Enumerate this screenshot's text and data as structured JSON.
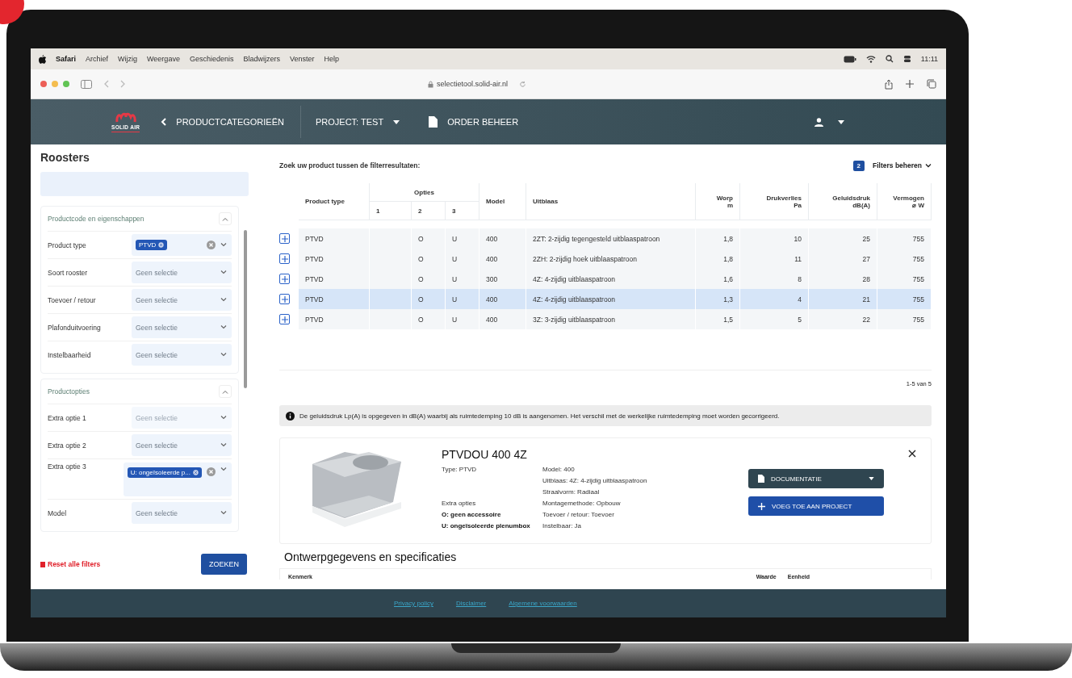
{
  "menubar": {
    "items": [
      "Safari",
      "Archief",
      "Wijzig",
      "Weergave",
      "Geschiedenis",
      "Bladwijzers",
      "Venster",
      "Help"
    ],
    "time": "11:11"
  },
  "browser": {
    "url": "selectietool.solid-air.nl"
  },
  "header": {
    "logo": "SOLID AIR",
    "back": "PRODUCTCATEGORIEËN",
    "project": "PROJECT: TEST",
    "orders": "ORDER BEHEER"
  },
  "sidebar": {
    "title": "Roosters",
    "groups": [
      {
        "title": "Productcode en eigenschappen",
        "expanded": true,
        "filters": [
          {
            "label": "Product type",
            "chips": [
              "PTVD"
            ],
            "disabled": false
          },
          {
            "label": "Soort rooster",
            "placeholder": "Geen selectie",
            "disabled": false
          },
          {
            "label": "Toevoer / retour",
            "placeholder": "Geen selectie",
            "disabled": false
          },
          {
            "label": "Plafonduitvoering",
            "placeholder": "Geen selectie",
            "disabled": false
          },
          {
            "label": "Instelbaarheid",
            "placeholder": "Geen selectie",
            "disabled": false
          }
        ]
      },
      {
        "title": "Productopties",
        "expanded": true,
        "filters": [
          {
            "label": "Extra optie 1",
            "placeholder": "Geen selectie",
            "disabled": true
          },
          {
            "label": "Extra optie 2",
            "placeholder": "Geen selectie",
            "disabled": false
          },
          {
            "label": "Extra optie 3",
            "chips": [
              "U: ongeïsoleerde p..."
            ],
            "disabled": false
          },
          {
            "label": "Model",
            "placeholder": "Geen selectie",
            "disabled": false
          }
        ]
      }
    ],
    "reset": "Reset alle filters",
    "search_button": "ZOEKEN"
  },
  "main": {
    "hint": "Zoek uw product tussen de filterresultaten:",
    "filter_count": "2",
    "filters_button": "Filters beheren",
    "table": {
      "columns": [
        {
          "label": "Product type"
        },
        {
          "label": "Opties",
          "sub": [
            "1",
            "2",
            "3"
          ]
        },
        {
          "label": "Model"
        },
        {
          "label": "Uitblaas"
        },
        {
          "label": "Worp",
          "unit": "m"
        },
        {
          "label": "Drukverlies",
          "unit": "Pa"
        },
        {
          "label": "Geluidsdruk",
          "unit": "dB(A)"
        },
        {
          "label": "Vermogen",
          "unit": "⌀ W"
        }
      ],
      "rows": [
        {
          "product_type": "PTVD",
          "option_2": "O",
          "option_3": "U",
          "model": "400",
          "uitblaas": "2ZT: 2-zijdig tegengesteld uitblaaspatroon",
          "worp": "1,8",
          "drukverlies": "10",
          "geluidsdruk": "25",
          "vermogen": "755",
          "selected": false
        },
        {
          "product_type": "PTVD",
          "option_2": "O",
          "option_3": "U",
          "model": "400",
          "uitblaas": "2ZH: 2-zijdig hoek uitblaaspatroon",
          "worp": "1,8",
          "drukverlies": "11",
          "geluidsdruk": "27",
          "vermogen": "755",
          "selected": false
        },
        {
          "product_type": "PTVD",
          "option_2": "O",
          "option_3": "U",
          "model": "300",
          "uitblaas": "4Z: 4-zijdig uitblaaspatroon",
          "worp": "1,6",
          "drukverlies": "8",
          "geluidsdruk": "28",
          "vermogen": "755",
          "selected": false
        },
        {
          "product_type": "PTVD",
          "option_2": "O",
          "option_3": "U",
          "model": "400",
          "uitblaas": "4Z: 4-zijdig uitblaaspatroon",
          "worp": "1,3",
          "drukverlies": "4",
          "geluidsdruk": "21",
          "vermogen": "755",
          "selected": true
        },
        {
          "product_type": "PTVD",
          "option_2": "O",
          "option_3": "U",
          "model": "400",
          "uitblaas": "3Z: 3-zijdig uitblaaspatroon",
          "worp": "1,5",
          "drukverlies": "5",
          "geluidsdruk": "22",
          "vermogen": "755",
          "selected": false
        }
      ]
    },
    "pagination": "1-5 van 5",
    "info": "De geluidsdruk Lp(A) is opgegeven in dB(A) waarbij als ruimtedemping 10 dB is aangenomen. Het verschil met de werkelijke ruimtedemping moet worden gecorrigeerd.",
    "detail": {
      "title": "PTVDOU 400 4Z",
      "type": "Type: PTVD",
      "extra_label": "Extra opties",
      "options": [
        "O: geen accessoire",
        "U: ongeïsoleerde plenumbox"
      ],
      "specs": [
        "Model: 400",
        "Uitblaas: 4Z: 4-zijdig uitblaaspatroon",
        "Straalvorm: Radiaal",
        "Montagemethode: Opbouw",
        "Toevoer / retour: Toevoer",
        "Instelbaar: Ja"
      ],
      "buttons": [
        {
          "label": "DOCUMENTATIE",
          "kind": "dropdown"
        },
        {
          "label": "VOEG TOE AAN PROJECT",
          "kind": "add"
        }
      ]
    },
    "spec_section": {
      "title": "Ontwerpgegevens en specificaties",
      "columns": [
        "Kenmerk",
        "Waarde",
        "Eenheid"
      ]
    }
  },
  "footer": {
    "links": [
      "Privacy policy",
      "Disclaimer",
      "Algemene voorwaarden"
    ]
  }
}
